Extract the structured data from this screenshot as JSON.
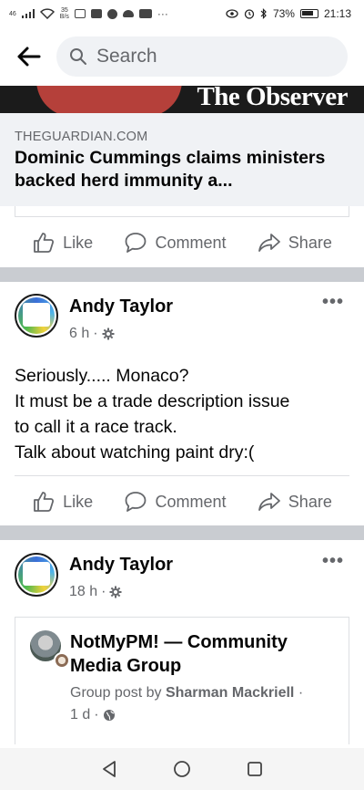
{
  "status_bar": {
    "network": "46",
    "speed": "35",
    "speed_unit": "B/s",
    "battery": "73%",
    "time": "21:13"
  },
  "search": {
    "placeholder": "Search"
  },
  "link_preview": {
    "masthead": "The Observer",
    "domain": "THEGUARDIAN.COM",
    "title": "Dominic Cummings claims ministers backed herd immunity a..."
  },
  "actions": {
    "like": "Like",
    "comment": "Comment",
    "share": "Share"
  },
  "posts": [
    {
      "author": "Andy Taylor",
      "time": "6 h",
      "more": "•••",
      "lines": [
        "Seriously..... Monaco?",
        "It must be a trade description issue",
        "to call it a race track.",
        "Talk about watching paint dry:("
      ]
    },
    {
      "author": "Andy Taylor",
      "time": "18 h",
      "more": "•••",
      "shared": {
        "group_name": "NotMyPM! — Community Media Group",
        "sub_prefix": "Group post by",
        "sub_author": "Sharman Mackriell",
        "time": "1 d"
      }
    }
  ],
  "colors": {
    "secondary_text": "#65676b",
    "separator": "#c9ccd1",
    "search_bg": "#f0f2f5"
  }
}
